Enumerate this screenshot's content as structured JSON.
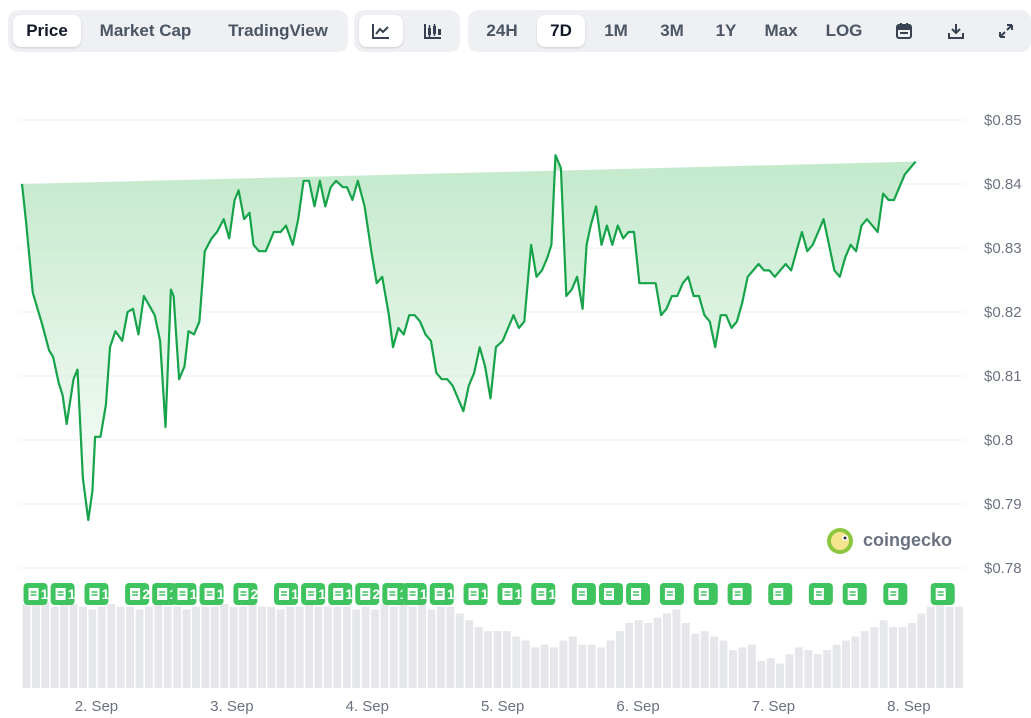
{
  "toolbar": {
    "view_tabs": [
      "Price",
      "Market Cap",
      "TradingView"
    ],
    "active_view": "Price",
    "chart_type_icons": [
      "line-chart-icon",
      "candlestick-icon"
    ],
    "active_chart_type": "line-chart-icon",
    "ranges": [
      "24H",
      "7D",
      "1M",
      "3M",
      "1Y",
      "Max",
      "LOG"
    ],
    "active_range": "7D",
    "tool_icons": [
      "calendar-icon",
      "download-icon",
      "expand-icon"
    ]
  },
  "watermark": "coingecko",
  "colors": {
    "line": "#16a34a",
    "fill_top": "#bfe8c8",
    "badge": "#3fc35f",
    "volume": "#e5e7eb",
    "grid": "#eef0f2"
  },
  "news_badges": [
    "1",
    "1",
    "1",
    "2",
    "1",
    "1",
    "1",
    "2",
    "1",
    "1",
    "1",
    "2",
    "1",
    "1",
    "1",
    "1",
    "1",
    "1"
  ],
  "chart_data": {
    "type": "area",
    "ylim": [
      0.78,
      0.85
    ],
    "y_ticks": [
      "$0.85",
      "$0.84",
      "$0.83",
      "$0.82",
      "$0.81",
      "$0.8",
      "$0.79",
      "$0.78"
    ],
    "x_ticks": [
      "2. Sep",
      "3. Sep",
      "4. Sep",
      "5. Sep",
      "6. Sep",
      "7. Sep",
      "8. Sep"
    ],
    "x_tick_positions_days": [
      0.55,
      1.55,
      2.55,
      3.55,
      4.55,
      5.55,
      6.55
    ],
    "grid": true,
    "series": [
      {
        "days": [
          0.0,
          0.03,
          0.08,
          0.15,
          0.2,
          0.23,
          0.27,
          0.3,
          0.33,
          0.38,
          0.41,
          0.45,
          0.49,
          0.52,
          0.54,
          0.58,
          0.62,
          0.65,
          0.69,
          0.74,
          0.78,
          0.82,
          0.86,
          0.9,
          0.94,
          0.98,
          1.02,
          1.06,
          1.1,
          1.12,
          1.16,
          1.2,
          1.23,
          1.27,
          1.31,
          1.35,
          1.4,
          1.44,
          1.49,
          1.53,
          1.57,
          1.6,
          1.64,
          1.68,
          1.71,
          1.75,
          1.8,
          1.83,
          1.86,
          1.91,
          1.95,
          2.0,
          2.04,
          2.08,
          2.12,
          2.16,
          2.2,
          2.24,
          2.28,
          2.32,
          2.37,
          2.4,
          2.44,
          2.48,
          2.53,
          2.58,
          2.62,
          2.66,
          2.71,
          2.74,
          2.78,
          2.82,
          2.86,
          2.9,
          2.94,
          2.98,
          3.02,
          3.06,
          3.1,
          3.14,
          3.18,
          3.22,
          3.26,
          3.3,
          3.34,
          3.38,
          3.42,
          3.46,
          3.5,
          3.55,
          3.59,
          3.63,
          3.67,
          3.71,
          3.76,
          3.8,
          3.84,
          3.88,
          3.91,
          3.94,
          3.98,
          4.02,
          4.06,
          4.1,
          4.14,
          4.17,
          4.2,
          4.24,
          4.28,
          4.32,
          4.36,
          4.4,
          4.44,
          4.48,
          4.52,
          4.56,
          4.6,
          4.64,
          4.68,
          4.72,
          4.76,
          4.8,
          4.84,
          4.88,
          4.92,
          4.96,
          5.0,
          5.04,
          5.08,
          5.12,
          5.16,
          5.2,
          5.24,
          5.28,
          5.32,
          5.36,
          5.4,
          5.44,
          5.48,
          5.52,
          5.56,
          5.6,
          5.64,
          5.68,
          5.72,
          5.76,
          5.8,
          5.84,
          5.88,
          5.92,
          5.96,
          6.0,
          6.04,
          6.08,
          6.12,
          6.16,
          6.2,
          6.24,
          6.28,
          6.32,
          6.36,
          6.4,
          6.44,
          6.48,
          6.52,
          6.56,
          6.6,
          6.64,
          6.68,
          6.72,
          6.76,
          6.8,
          6.84,
          6.88,
          6.92,
          6.96
        ],
        "prices": [
          0.84,
          0.834,
          0.823,
          0.818,
          0.814,
          0.813,
          0.809,
          0.807,
          0.8025,
          0.8095,
          0.811,
          0.794,
          0.7875,
          0.792,
          0.8005,
          0.8005,
          0.8055,
          0.8145,
          0.817,
          0.8155,
          0.82,
          0.8205,
          0.8165,
          0.8225,
          0.821,
          0.8195,
          0.8155,
          0.802,
          0.8235,
          0.8225,
          0.8095,
          0.8115,
          0.817,
          0.8165,
          0.8185,
          0.8295,
          0.8315,
          0.8325,
          0.8345,
          0.8315,
          0.8375,
          0.839,
          0.8345,
          0.8355,
          0.8305,
          0.8295,
          0.8295,
          0.831,
          0.8325,
          0.8325,
          0.8335,
          0.8305,
          0.8345,
          0.8405,
          0.8405,
          0.8365,
          0.8405,
          0.8365,
          0.8395,
          0.8405,
          0.8395,
          0.8395,
          0.8375,
          0.8405,
          0.8365,
          0.8295,
          0.8245,
          0.8255,
          0.8195,
          0.8145,
          0.8175,
          0.8165,
          0.8195,
          0.8195,
          0.8185,
          0.8165,
          0.8155,
          0.8105,
          0.8095,
          0.8095,
          0.8085,
          0.8065,
          0.8045,
          0.8085,
          0.8105,
          0.8145,
          0.8115,
          0.8065,
          0.8145,
          0.8155,
          0.8175,
          0.8195,
          0.8175,
          0.8185,
          0.8305,
          0.8255,
          0.8265,
          0.8285,
          0.8305,
          0.8445,
          0.8425,
          0.8225,
          0.8235,
          0.8255,
          0.8205,
          0.8305,
          0.8335,
          0.8365,
          0.8305,
          0.8335,
          0.8305,
          0.8335,
          0.8315,
          0.8325,
          0.8325,
          0.8245,
          0.8245,
          0.8245,
          0.8245,
          0.8195,
          0.8205,
          0.8225,
          0.8225,
          0.8245,
          0.8255,
          0.8225,
          0.8225,
          0.8195,
          0.8185,
          0.8145,
          0.8195,
          0.8195,
          0.8175,
          0.8185,
          0.8215,
          0.8255,
          0.8265,
          0.8275,
          0.8265,
          0.8265,
          0.8255,
          0.8265,
          0.8275,
          0.8265,
          0.8295,
          0.8325,
          0.8295,
          0.8305,
          0.8325,
          0.8345,
          0.8305,
          0.8265,
          0.8255,
          0.8285,
          0.8305,
          0.8295,
          0.8335,
          0.8345,
          0.8335,
          0.8325,
          0.8385,
          0.8375,
          0.8375,
          0.8395,
          0.8415,
          0.8425,
          0.8435
        ]
      }
    ],
    "news_days": [
      0.1,
      0.3,
      0.55,
      0.85,
      1.05,
      1.2,
      1.4,
      1.65,
      1.95,
      2.15,
      2.35,
      2.55,
      2.75,
      2.9,
      3.1,
      3.35,
      3.6,
      3.85,
      4.15,
      4.35,
      4.55,
      4.8,
      5.05,
      5.3,
      5.6,
      5.9,
      6.15,
      6.45,
      6.8
    ],
    "volume_relative": [
      0.62,
      0.62,
      0.63,
      0.6,
      0.61,
      0.62,
      0.6,
      0.58,
      0.6,
      0.62,
      0.6,
      0.6,
      0.58,
      0.6,
      0.62,
      0.6,
      0.6,
      0.58,
      0.6,
      0.6,
      0.6,
      0.62,
      0.6,
      0.6,
      0.62,
      0.6,
      0.6,
      0.58,
      0.6,
      0.6,
      0.62,
      0.6,
      0.6,
      0.6,
      0.6,
      0.58,
      0.6,
      0.58,
      0.62,
      0.6,
      0.62,
      0.6,
      0.62,
      0.58,
      0.6,
      0.6,
      0.55,
      0.5,
      0.45,
      0.42,
      0.42,
      0.42,
      0.38,
      0.35,
      0.3,
      0.32,
      0.3,
      0.35,
      0.38,
      0.32,
      0.32,
      0.3,
      0.35,
      0.42,
      0.48,
      0.5,
      0.48,
      0.52,
      0.55,
      0.58,
      0.48,
      0.4,
      0.42,
      0.38,
      0.35,
      0.28,
      0.3,
      0.32,
      0.2,
      0.22,
      0.18,
      0.25,
      0.3,
      0.28,
      0.25,
      0.28,
      0.32,
      0.35,
      0.38,
      0.42,
      0.45,
      0.5,
      0.45,
      0.45,
      0.48,
      0.55,
      0.6,
      0.62,
      0.6,
      0.6
    ]
  }
}
